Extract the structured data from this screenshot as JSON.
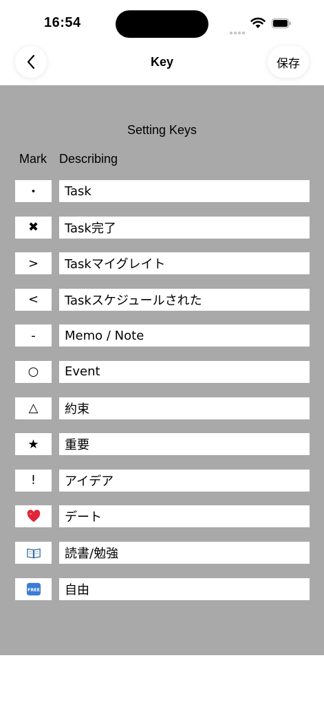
{
  "status_bar": {
    "time": "16:54"
  },
  "nav": {
    "title": "Key",
    "save_label": "保存"
  },
  "section_title": "Setting Keys",
  "columns": {
    "mark": "Mark",
    "describing": "Describing"
  },
  "rows": [
    {
      "mark": "・",
      "desc": "Task"
    },
    {
      "mark": "✖",
      "desc": "Task完了"
    },
    {
      "mark": ">",
      "desc": "Taskマイグレイト"
    },
    {
      "mark": "<",
      "desc": "Taskスケジュールされた"
    },
    {
      "mark": "-",
      "desc": "Memo / Note"
    },
    {
      "mark": "○",
      "desc": "Event"
    },
    {
      "mark": "△",
      "desc": "約束"
    },
    {
      "mark": "★",
      "desc": "重要"
    },
    {
      "mark": "!",
      "desc": "アイデア"
    },
    {
      "mark": "heart-emoji-icon",
      "desc": "デート"
    },
    {
      "mark": "book-emoji-icon",
      "desc": "読書/勉強"
    },
    {
      "mark": "free-emoji-icon",
      "desc": "自由"
    }
  ],
  "colors": {
    "content_bg": "#a9a9a9",
    "field_bg": "#ffffff",
    "heart": "#e0243a",
    "free_badge": "#3b7dd8"
  }
}
